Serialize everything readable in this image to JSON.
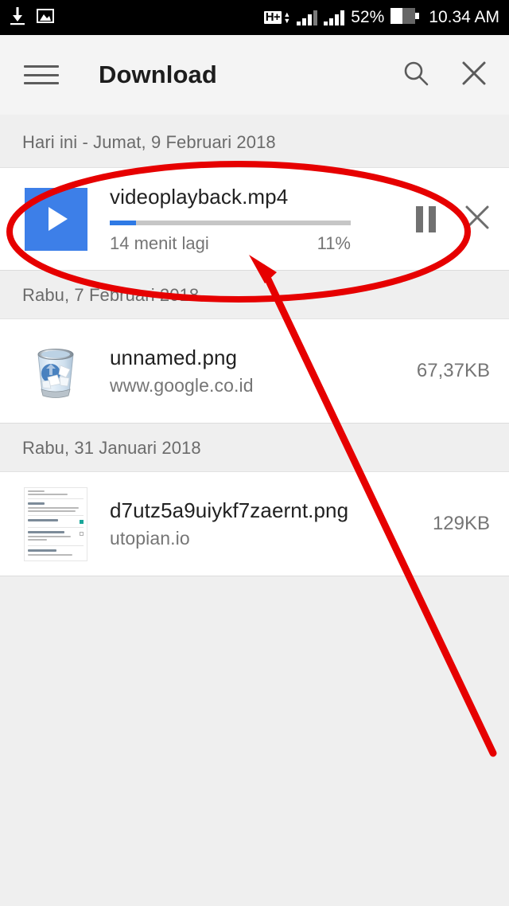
{
  "status_bar": {
    "left_icons": [
      "download-icon",
      "image-icon"
    ],
    "network_type": "H+",
    "battery_percent": "52%",
    "time": "10.34 AM",
    "background_color": "#000000"
  },
  "app_bar": {
    "menu_icon": "hamburger-icon",
    "title": "Download",
    "search_icon": "search-icon",
    "close_icon": "close-icon",
    "background_color": "#f4f4f4"
  },
  "sections": [
    {
      "header": "Hari ini - Jumat, 9 Februari 2018",
      "items": [
        {
          "type": "downloading",
          "thumb": "video-play-thumbnail",
          "thumb_color": "#3d7fe8",
          "filename": "videoplayback.mp4",
          "time_remaining": "14 menit lagi",
          "percent_label": "11%",
          "progress_value": 11,
          "progress_color": "#2f7ae5",
          "pause_icon": "pause-icon",
          "cancel_icon": "close-icon"
        }
      ]
    },
    {
      "header": "Rabu, 7 Februari 2018",
      "items": [
        {
          "type": "completed",
          "thumb": "recycle-bin-thumbnail",
          "filename": "unnamed.png",
          "source": "www.google.co.id",
          "filesize": "67,37KB"
        }
      ]
    },
    {
      "header": "Rabu, 31 Januari 2018",
      "items": [
        {
          "type": "completed",
          "thumb": "settings-screenshot-thumbnail",
          "filename": "d7utz5a9uiykf7zaernt.png",
          "source": "utopian.io",
          "filesize": "129KB"
        }
      ]
    }
  ],
  "thumbnail_screenshot": {
    "line_top": "Current step size 75.00 cm",
    "row1_title": "Account",
    "row1_desc": "Sign in with your Google account to use the Achievements and Leaderboards features",
    "row2_title": "Show notification",
    "row3_title": "Pause while charging",
    "row3_desc": "Pause Pedometer while device is charging",
    "row4_title": "Export/Backup",
    "row4_desc": "Save your data in a .csv file"
  },
  "annotations": {
    "color": "#e60000",
    "ellipse_label": "red-ellipse-highlight",
    "arrow_label": "red-arrow-pointer"
  }
}
